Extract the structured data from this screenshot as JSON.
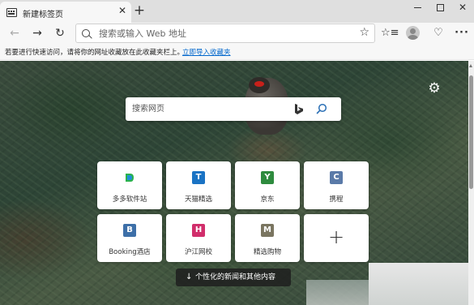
{
  "tab": {
    "title": "新建标签页",
    "close": "✕"
  },
  "new_tab": "+",
  "window": {
    "minimize": "",
    "maximize": "",
    "close": "✕"
  },
  "toolbar": {
    "back": "←",
    "forward": "→",
    "reload": "↻",
    "address_placeholder": "搜索或输入 Web 地址",
    "star": "☆",
    "favorites": "☆≡",
    "feedback": "♡",
    "more": "···"
  },
  "favbar": {
    "text": "若要进行快速访问，请将你的网址收藏放在此收藏夹栏上。",
    "link": "立即导入收藏夹"
  },
  "settings_icon": "⚙",
  "search": {
    "placeholder": "搜索网页"
  },
  "tiles": [
    {
      "label": "多多软件站",
      "letter": "D",
      "color": "#ffffff"
    },
    {
      "label": "天猫精选",
      "letter": "T",
      "color": "#1a73c4"
    },
    {
      "label": "京东",
      "letter": "Y",
      "color": "#2e8b3e"
    },
    {
      "label": "携程",
      "letter": "C",
      "color": "#5a7aa8"
    },
    {
      "label": "Booking酒店",
      "letter": "B",
      "color": "#3d6fa8"
    },
    {
      "label": "沪江网校",
      "letter": "H",
      "color": "#d12e6b"
    },
    {
      "label": "精选购物",
      "letter": "M",
      "color": "#7a7560"
    },
    {
      "label": "",
      "letter": "+",
      "color": "#ffffff"
    }
  ],
  "news": {
    "arrow": "↓",
    "text": "个性化的新闻和其他内容"
  }
}
